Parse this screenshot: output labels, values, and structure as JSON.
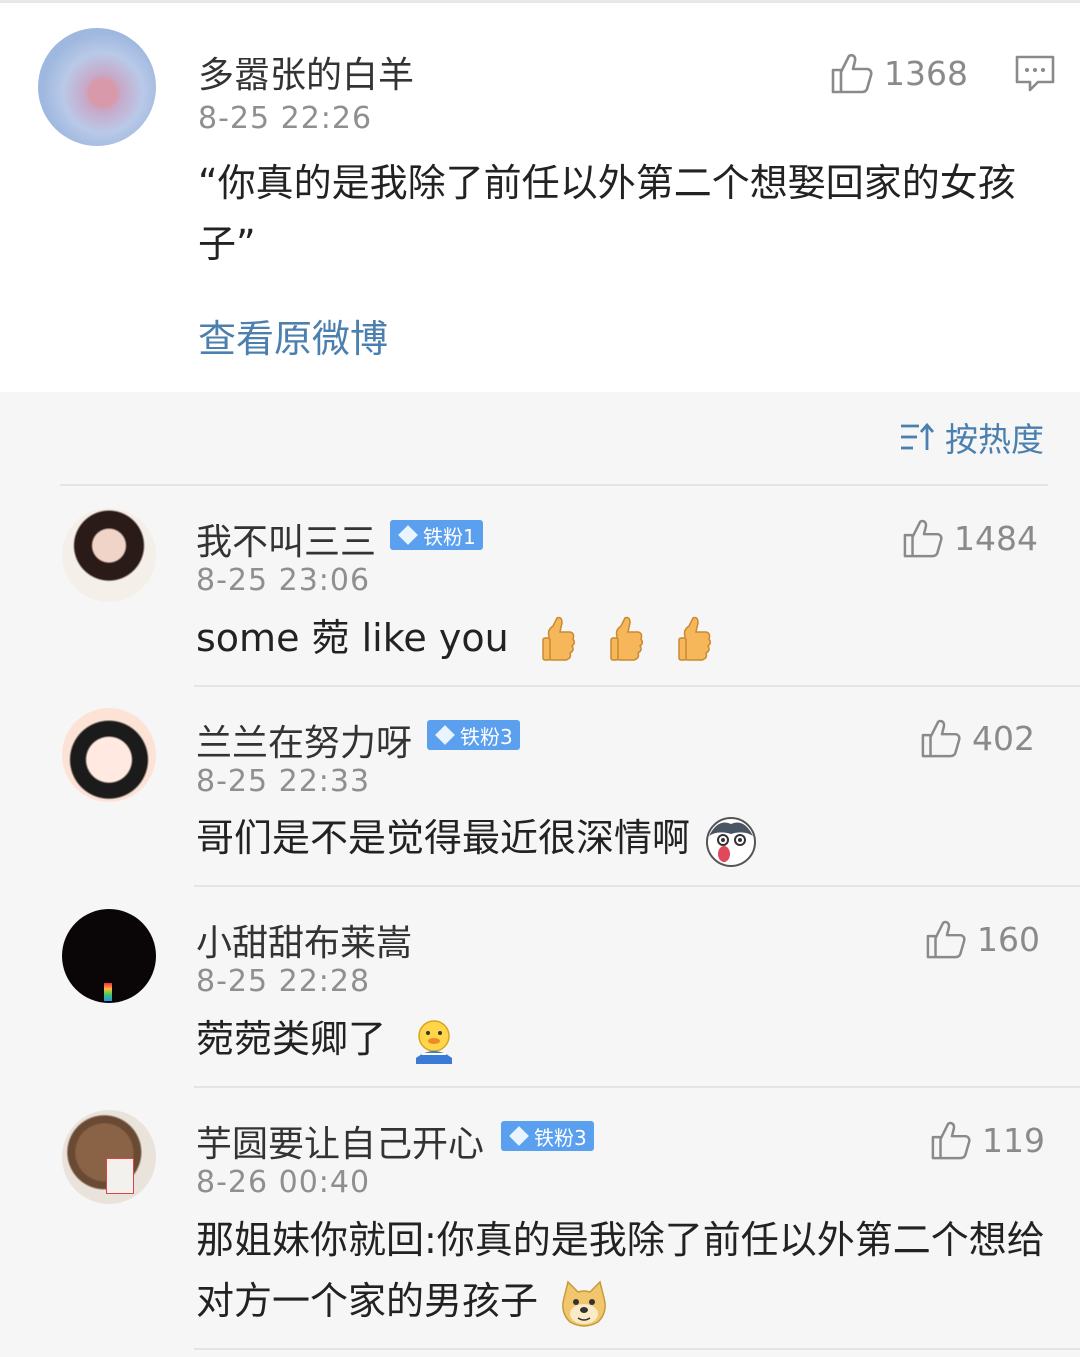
{
  "post": {
    "author": "多嚣张的白羊",
    "time": "8-25 22:26",
    "likes": "1368",
    "text": "“你真的是我除了前任以外第二个想娶回家的女孩子”",
    "view_original": "查看原微博"
  },
  "sort": {
    "label": "按热度"
  },
  "comments": [
    {
      "name": "我不叫三三",
      "badge": "铁粉1",
      "time": "8-25 23:06",
      "likes": "1484",
      "text": "some 菀 like you"
    },
    {
      "name": "兰兰在努力呀",
      "badge": "铁粉3",
      "time": "8-25 22:33",
      "likes": "402",
      "text": "哥们是不是觉得最近很深情啊"
    },
    {
      "name": "小甜甜布莱嵩",
      "time": "8-25 22:28",
      "likes": "160",
      "text": "菀菀类卿了"
    },
    {
      "name": "芋圆要让自己开心",
      "badge": "铁粉3",
      "time": "8-26 00:40",
      "likes": "119",
      "text": "那姐妹你就回:你真的是我除了前任以外第二个想给对方一个家的男孩子"
    }
  ],
  "colors": {
    "link": "#4b7fae",
    "badge": "#5aa0ee",
    "meta": "#8f8f8f"
  },
  "icons": {
    "like": "thumbs-up-icon",
    "comment": "comment-icon",
    "sort": "sort-icon"
  }
}
